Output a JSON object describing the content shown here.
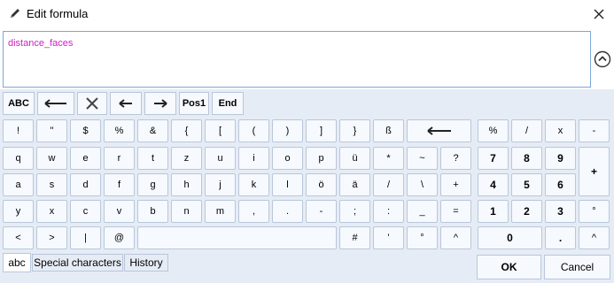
{
  "window": {
    "title": "Edit formula"
  },
  "editor": {
    "formula": "distance_faces"
  },
  "toolbar": {
    "abc_caps": "ABC",
    "pos1": "Pos1",
    "end": "End"
  },
  "keys_row1": [
    "!",
    "\"",
    "$",
    "%",
    "&",
    "{",
    "[",
    "(",
    ")",
    "]",
    "}",
    "ß"
  ],
  "keys_row2": [
    "q",
    "w",
    "e",
    "r",
    "t",
    "z",
    "u",
    "i",
    "o",
    "p",
    "ü",
    "*",
    "~",
    "?"
  ],
  "keys_row3": [
    "a",
    "s",
    "d",
    "f",
    "g",
    "h",
    "j",
    "k",
    "l",
    "ö",
    "ä",
    "/",
    "\\",
    "+"
  ],
  "keys_row4": [
    "y",
    "x",
    "c",
    "v",
    "b",
    "n",
    "m",
    ",",
    ".",
    "-",
    ";",
    ":",
    "_",
    "="
  ],
  "keys_row5": [
    "<",
    ">",
    "|",
    "@",
    "#",
    "'",
    "°",
    "^"
  ],
  "numpad": {
    "r1": [
      "%",
      "/",
      "x",
      "-"
    ],
    "r2": [
      "7",
      "8",
      "9"
    ],
    "r3": [
      "4",
      "5",
      "6"
    ],
    "plus": "+",
    "r4": [
      "1",
      "2",
      "3",
      "°"
    ],
    "zero": "0",
    "dot": ".",
    "caret": "^"
  },
  "tabs": [
    "abc",
    "Special characters",
    "History"
  ],
  "buttons": {
    "ok": "OK",
    "cancel": "Cancel"
  }
}
